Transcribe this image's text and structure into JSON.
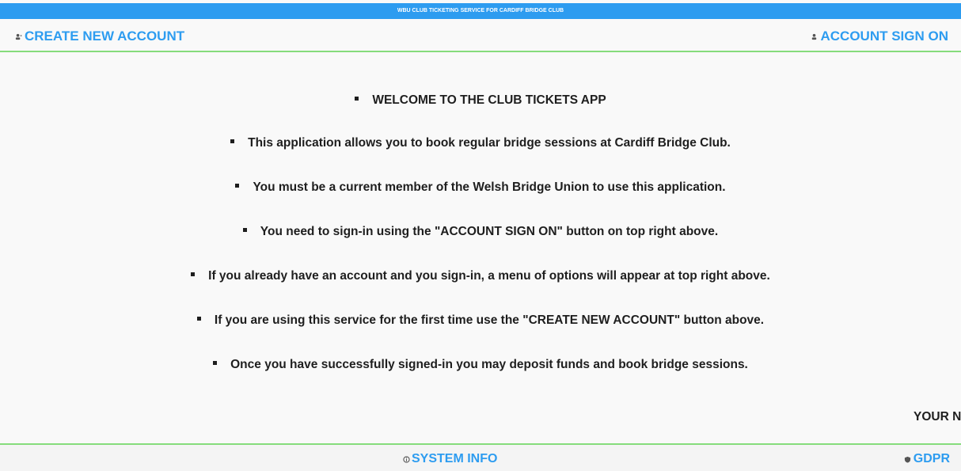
{
  "topbar": {
    "title": "WBU CLUB TICKETING SERVICE FOR CARDIFF BRIDGE CLUB"
  },
  "header": {
    "create_account": "CREATE NEW ACCOUNT",
    "sign_on": "ACCOUNT SIGN ON"
  },
  "main": {
    "items": [
      "WELCOME TO THE CLUB TICKETS APP",
      "This application allows you to book regular bridge sessions at Cardiff Bridge Club.",
      "You must be a current member of the Welsh Bridge Union to use this application.",
      "You need to sign-in using the \"ACCOUNT SIGN ON\" button on top right above.",
      "If you already have an account and you sign-in, a menu of options will appear at top right above.",
      "If you are using this service for the first time use the \"CREATE NEW ACCOUNT\" button above.",
      "Once you have successfully signed-in you may deposit funds and book bridge sessions."
    ],
    "next_label": "YOUR NEXT"
  },
  "footer": {
    "system_info": "SYSTEM INFO",
    "gdpr": "GDPR"
  },
  "colors": {
    "accent": "#2d9cf0",
    "divider": "#86dc7c",
    "text": "#1e1e1e"
  },
  "icons": {
    "create_account": "person-add-icon",
    "sign_on": "person-icon",
    "system_info": "info-icon",
    "gdpr": "shield-icon"
  }
}
